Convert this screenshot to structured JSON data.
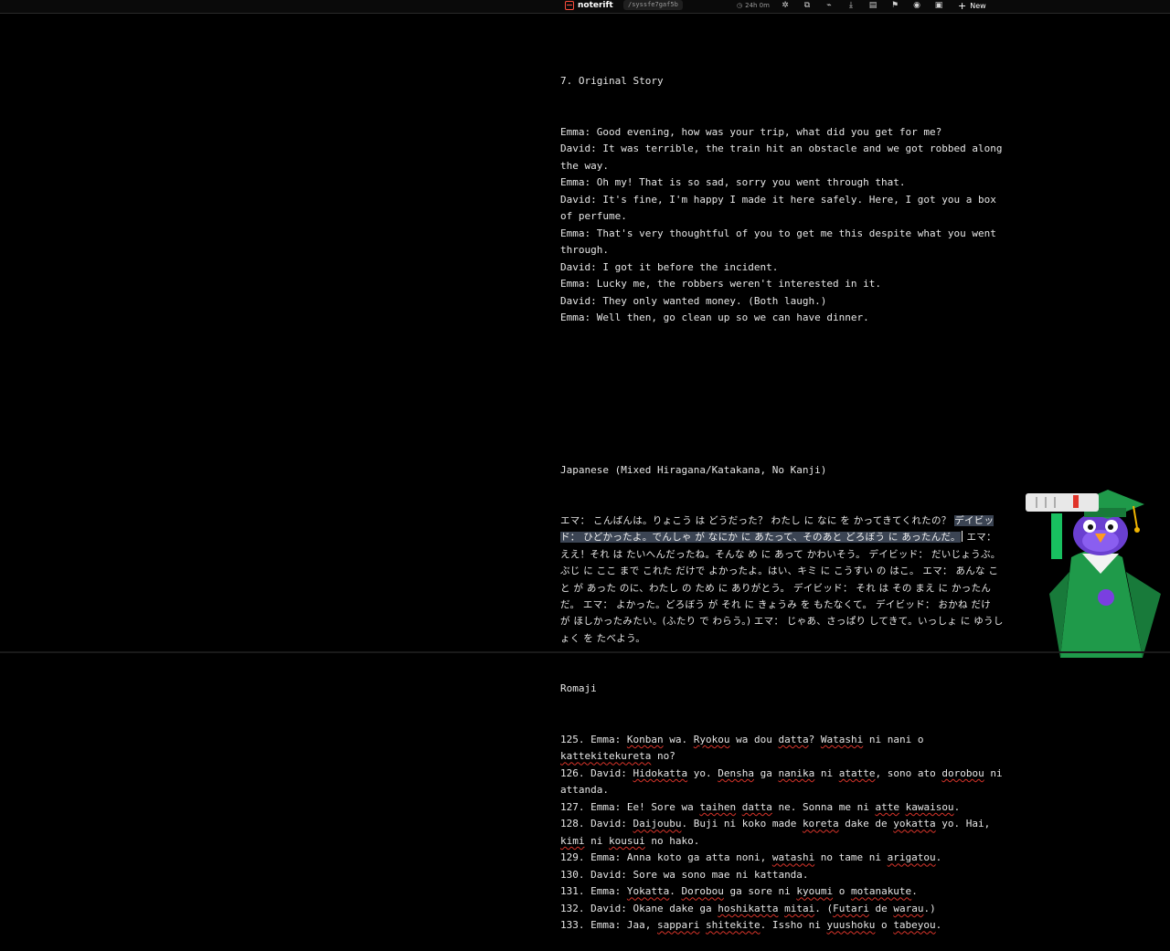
{
  "topbar": {
    "app_name": "noterift",
    "path": "/syssfe7gaf5b",
    "timer": "24h 0m",
    "new_label": "New"
  },
  "icons": [
    "clock-icon",
    "settings-icon",
    "copy-icon",
    "link-icon",
    "download-icon",
    "columns-icon",
    "flag-icon",
    "eye-icon",
    "lock-icon",
    "plus-icon",
    "pencil-icon"
  ],
  "colors": {
    "background": "#000000",
    "text": "#e6e6e6",
    "selection": "#3b4453",
    "spellcheck": "#d8342a",
    "brand": "#ff4d3d",
    "mascot_robe": "#1f9a4a",
    "mascot_bird": "#6a3fd0"
  },
  "doc": {
    "story_heading": "7. Original Story",
    "story": [
      "Emma: Good evening, how was your trip, what did you get for me?",
      "David: It was terrible, the train hit an obstacle and we got robbed along the way.",
      "Emma: Oh my! That is so sad, sorry you went through that.",
      "David: It's fine, I'm happy I made it here safely. Here, I got you a box of perfume.",
      "Emma: That's very thoughtful of you to get me this despite what you went through.",
      "David: I got it before the incident.",
      "Emma: Lucky me, the robbers weren't interested in it.",
      "David: They only wanted money. (Both laugh.)",
      "Emma: Well then, go clean up so we can have dinner."
    ],
    "japanese_heading": "Japanese (Mixed Hiragana/Katakana, No Kanji)",
    "japanese_before": "エマ： こんばんは。りょこう は どうだった？ わたし に なに を かってきてくれたの？ ",
    "japanese_selected": "デイビッド： ひどかったよ。でんしゃ が なにか に あたって、そのあと どろぼう に あったんだ。",
    "japanese_after": " エマ： ええ！それ は たいへんだったね。そんな め に あって かわいそう。 デイビッド： だいじょうぶ。ぶじ に ここ まで これた だけで よかったよ。はい、キミ に こうすい の はこ。 エマ： あんな こと が あった のに、わたし の ため に ありがとう。 デイビッド： それ は その まえ に かったんだ。 エマ： よかった。どろぼう が それ に きょうみ を もたなくて。 デイビッド： おかね だけ が ほしかったみたい。(ふたり で わらう。) エマ： じゃあ、さっぱり してきて。いっしょ に ゆうしょく を たべよう。",
    "romaji_heading": "Romaji",
    "romaji": [
      {
        "num": "125.",
        "speaker": "Emma:",
        "parts": [
          [
            "Konban",
            1
          ],
          [
            " wa. ",
            0
          ],
          [
            "Ryokou",
            1
          ],
          [
            " wa dou ",
            0
          ],
          [
            "datta",
            1
          ],
          [
            "? ",
            0
          ],
          [
            "Watashi",
            1
          ],
          [
            " ni nani o ",
            0
          ],
          [
            "kattekitekureta",
            1
          ],
          [
            " no?",
            0
          ]
        ]
      },
      {
        "num": "126.",
        "speaker": "David:",
        "parts": [
          [
            "Hidokatta",
            1
          ],
          [
            " yo. ",
            0
          ],
          [
            "Densha",
            1
          ],
          [
            " ga ",
            0
          ],
          [
            "nanika",
            1
          ],
          [
            " ni ",
            0
          ],
          [
            "atatte",
            1
          ],
          [
            ", sono ato ",
            0
          ],
          [
            "dorobou",
            1
          ],
          [
            " ni attanda.",
            0
          ]
        ]
      },
      {
        "num": "127.",
        "speaker": "Emma:",
        "parts": [
          [
            "Ee! Sore wa ",
            0
          ],
          [
            "taihen",
            1
          ],
          [
            " ",
            0
          ],
          [
            "datta",
            1
          ],
          [
            " ne. Sonna me ni ",
            0
          ],
          [
            "atte",
            1
          ],
          [
            " ",
            0
          ],
          [
            "kawaisou",
            1
          ],
          [
            ".",
            0
          ]
        ]
      },
      {
        "num": "128.",
        "speaker": "David:",
        "parts": [
          [
            "Daijoubu",
            1
          ],
          [
            ". Buji ni koko made ",
            0
          ],
          [
            "koreta",
            1
          ],
          [
            " dake de ",
            0
          ],
          [
            "yokatta",
            1
          ],
          [
            " yo. Hai, ",
            0
          ],
          [
            "kimi",
            1
          ],
          [
            " ni ",
            0
          ],
          [
            "kousui",
            1
          ],
          [
            " no hako.",
            0
          ]
        ]
      },
      {
        "num": "129.",
        "speaker": "Emma:",
        "parts": [
          [
            "Anna koto ga atta noni, ",
            0
          ],
          [
            "watashi",
            1
          ],
          [
            " no tame ni ",
            0
          ],
          [
            "arigatou",
            1
          ],
          [
            ".",
            0
          ]
        ]
      },
      {
        "num": "130.",
        "speaker": "David:",
        "parts": [
          [
            "Sore wa sono mae ni kattanda.",
            0
          ]
        ]
      },
      {
        "num": "131.",
        "speaker": "Emma:",
        "parts": [
          [
            "Yokatta",
            1
          ],
          [
            ". ",
            0
          ],
          [
            "Dorobou",
            1
          ],
          [
            " ga sore ni ",
            0
          ],
          [
            "kyoumi",
            1
          ],
          [
            " o ",
            0
          ],
          [
            "motanakute",
            1
          ],
          [
            ".",
            0
          ]
        ]
      },
      {
        "num": "132.",
        "speaker": "David:",
        "parts": [
          [
            "Okane dake ga ",
            0
          ],
          [
            "hoshikatta",
            1
          ],
          [
            " ",
            0
          ],
          [
            "mitai",
            1
          ],
          [
            ". (",
            0
          ],
          [
            "Futari",
            1
          ],
          [
            " de ",
            0
          ],
          [
            "warau",
            1
          ],
          [
            ".)",
            0
          ]
        ]
      },
      {
        "num": "133.",
        "speaker": "Emma:",
        "parts": [
          [
            "Jaa, ",
            0
          ],
          [
            "sappari",
            1
          ],
          [
            " ",
            0
          ],
          [
            "shitekite",
            1
          ],
          [
            ". Issho ni ",
            0
          ],
          [
            "yuushoku",
            1
          ],
          [
            " o ",
            0
          ],
          [
            "tabeyou",
            1
          ],
          [
            ".",
            0
          ]
        ]
      }
    ]
  }
}
